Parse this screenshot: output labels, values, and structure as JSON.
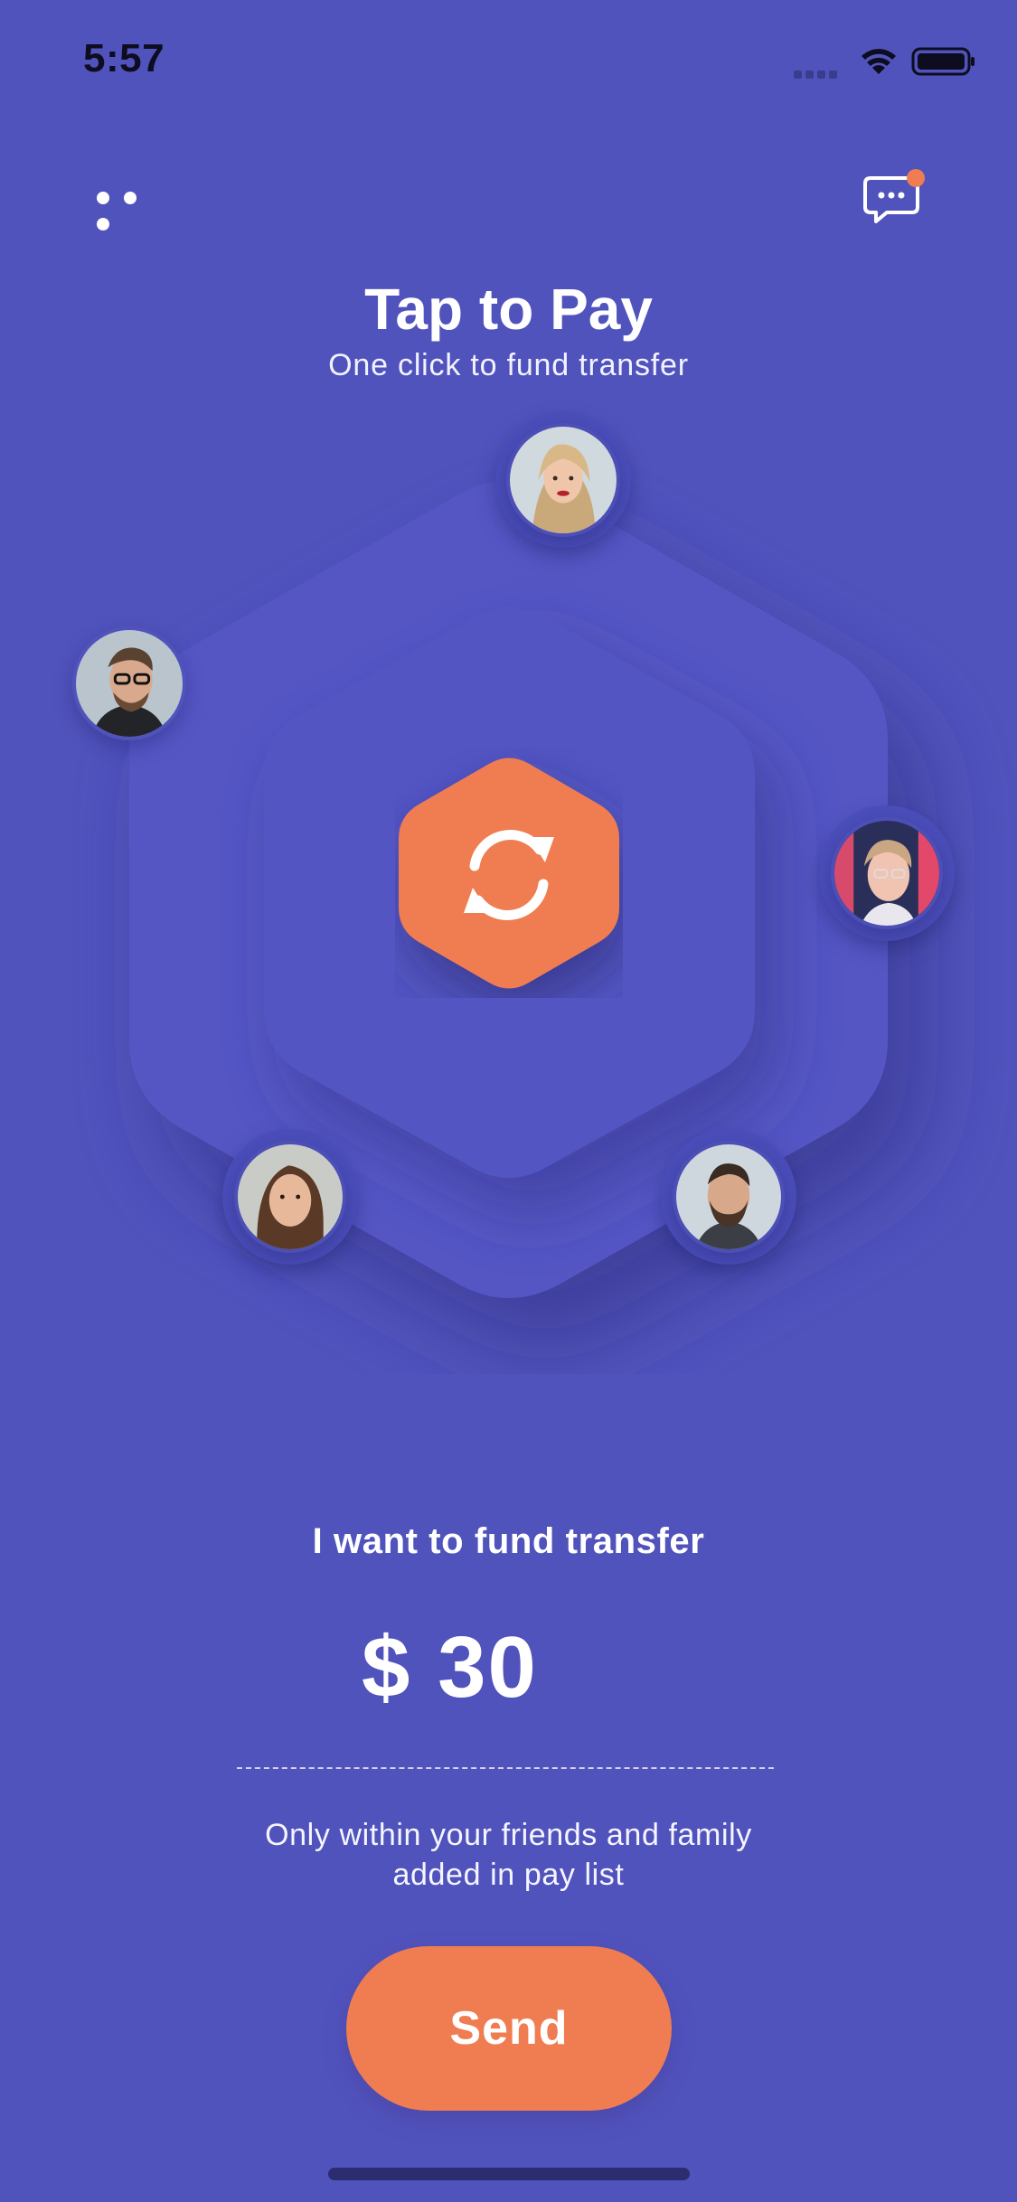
{
  "status_bar": {
    "time": "5:57"
  },
  "header": {
    "title": "Tap to Pay",
    "subtitle": "One click to fund transfer",
    "chat_has_notification": true
  },
  "contacts": [
    {
      "name": "contact-top"
    },
    {
      "name": "contact-left"
    },
    {
      "name": "contact-right"
    },
    {
      "name": "contact-bottom-left"
    },
    {
      "name": "contact-bottom-right"
    }
  ],
  "transfer": {
    "label": "I want to fund transfer",
    "amount": "$ 30",
    "note_line1": "Only within your friends and family",
    "note_line2": "added in pay list",
    "send_label": "Send"
  },
  "colors": {
    "background": "#5153bd",
    "accent": "#ef7d51",
    "hex_outer": "#5457c4",
    "hex_inner": "#5255c3",
    "notification_dot": "#ef7d51"
  },
  "icons": {
    "menu": "menu-dots-icon",
    "chat": "chat-bubble-icon",
    "refresh": "refresh-icon"
  }
}
